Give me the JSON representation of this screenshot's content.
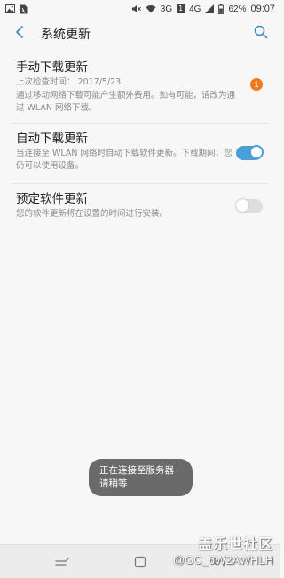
{
  "status_bar": {
    "network_3g": "3G",
    "sim_number": "1",
    "network_4g": "4G",
    "battery": "62%",
    "time": "09:07",
    "icons": [
      "image-icon",
      "file-icon",
      "mute-icon",
      "wifi-icon",
      "signal-icon",
      "battery-icon"
    ]
  },
  "header": {
    "title": "系统更新",
    "back_icon": "chevron-left-icon",
    "search_icon": "search-icon",
    "accent_color": "#3b8ec2"
  },
  "settings": {
    "manual": {
      "title": "手动下载更新",
      "last_check": "上次检查时间： 2017/5/23",
      "description": "通过移动网络下载可能产生额外费用。如有可能，请改为通过 WLAN 网络下载。",
      "badge": "1",
      "badge_color": "#f07a1d"
    },
    "auto": {
      "title": "自动下载更新",
      "description": "当连接至 WLAN 网络时自动下载软件更新。下载期间，您仍可以使用设备。",
      "enabled": true,
      "toggle_color": "#4a9fd6"
    },
    "scheduled": {
      "title": "预定软件更新",
      "description": "您的软件更新将在设置的时间进行安装。",
      "enabled": false
    }
  },
  "toast": {
    "line1": "正在连接至服务器",
    "line2": "请稍等"
  },
  "watermark": {
    "brand": "盖乐世社区",
    "user": "@GC_6W2AWHLH"
  },
  "nav_bar": {
    "icons": [
      "recent-apps-icon",
      "home-icon",
      "back-icon"
    ]
  }
}
